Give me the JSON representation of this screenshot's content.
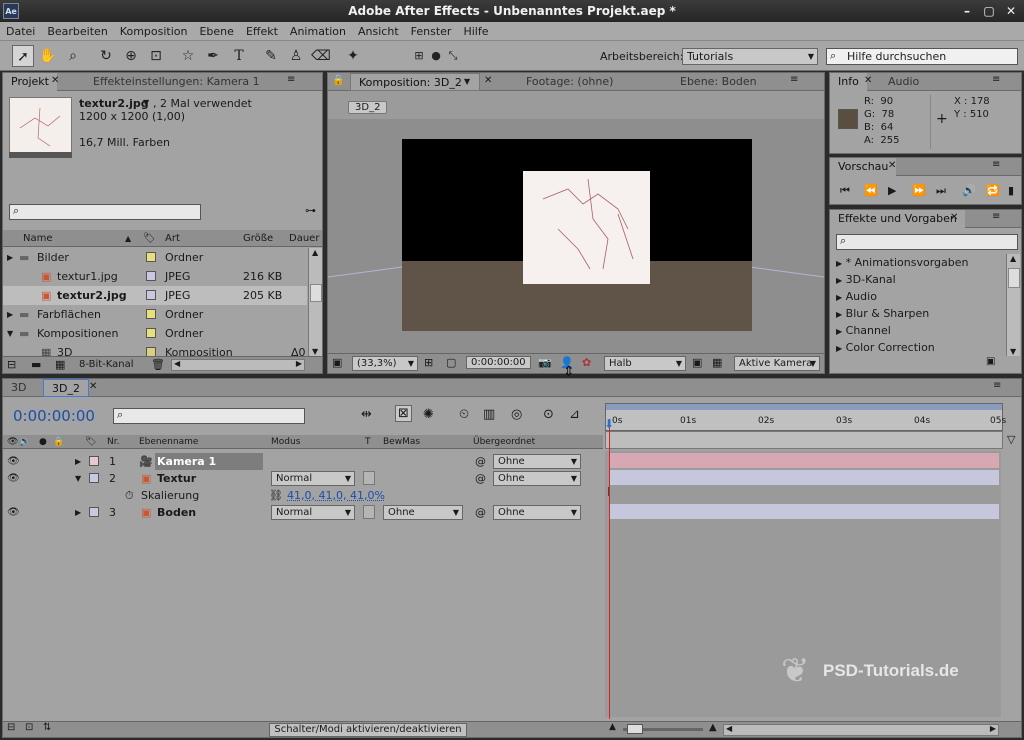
{
  "window": {
    "title": "Adobe After Effects - Unbenanntes Projekt.aep *",
    "app_icon": "Ae",
    "controls": [
      "–",
      "▢",
      "✕"
    ]
  },
  "menu": [
    "Datei",
    "Bearbeiten",
    "Komposition",
    "Ebene",
    "Effekt",
    "Animation",
    "Ansicht",
    "Fenster",
    "Hilfe"
  ],
  "toolbar": {
    "workspace_label": "Arbeitsbereich:",
    "workspace_value": "Tutorials",
    "help_placeholder": "Hilfe durchsuchen"
  },
  "project": {
    "tab_project": "Projekt",
    "tab_effects": "Effekteinstellungen: Kamera 1",
    "file_name": "textur2.jpg",
    "file_usage": ", 2 Mal verwendet",
    "file_size": "1200 x 1200 (1,00)",
    "file_colors": "16,7 Mill. Farben",
    "columns": [
      "Name",
      "Art",
      "Größe",
      "Dauer"
    ],
    "items": [
      {
        "name": "Bilder",
        "type": "Ordner",
        "size": "",
        "color": "#e8e07a"
      },
      {
        "name": "textur1.jpg",
        "type": "JPEG",
        "size": "216 KB",
        "color": "#c8c8e0"
      },
      {
        "name": "textur2.jpg",
        "type": "JPEG",
        "size": "205 KB",
        "color": "#c8c8e0"
      },
      {
        "name": "Farbflächen",
        "type": "Ordner",
        "size": "",
        "color": "#e8e07a"
      },
      {
        "name": "Kompositionen",
        "type": "Ordner",
        "size": "",
        "color": "#e8e07a"
      },
      {
        "name": "3D",
        "type": "Komposition",
        "size": "",
        "dur": "Δ0",
        "color": "#d8d080"
      }
    ],
    "bit_depth": "8-Bit-Kanal"
  },
  "comp": {
    "tab": "Komposition: 3D_2",
    "footage": "Footage: (ohne)",
    "layer": "Ebene: Boden",
    "badge": "3D_2",
    "zoom": "(33,3%)",
    "time": "0:00:00:00",
    "resolution": "Halb",
    "camera": "Aktive Kamera"
  },
  "info": {
    "tab_info": "Info",
    "tab_audio": "Audio",
    "r": "R:  90",
    "g": "G:  78",
    "b": "B:  64",
    "a": "A:  255",
    "x": "X : 178",
    "y": "Y : 510",
    "swatch": "#5a4e40"
  },
  "preview": {
    "tab": "Vorschau"
  },
  "effects": {
    "tab": "Effekte und Vorgaben",
    "items": [
      "* Animationsvorgaben",
      "3D-Kanal",
      "Audio",
      "Blur & Sharpen",
      "Channel",
      "Color Correction"
    ]
  },
  "timeline": {
    "tab_3d": "3D",
    "tab_3d2": "3D_2",
    "timecode": "0:00:00:00",
    "columns": [
      "Nr.",
      "Ebenenname",
      "Modus",
      "T",
      "BewMas",
      "Übergeordnet"
    ],
    "ticks": [
      "0s",
      "01s",
      "02s",
      "03s",
      "04s",
      "05s"
    ],
    "layers": [
      {
        "nr": "1",
        "name": "Kamera 1",
        "mode": "",
        "bewmas": "",
        "parent": "Ohne"
      },
      {
        "nr": "2",
        "name": "Textur",
        "mode": "Normal",
        "bewmas": "",
        "parent": "Ohne"
      },
      {
        "nr": "",
        "name": "Skalierung",
        "value": "41,0, 41,0, 41,0%"
      },
      {
        "nr": "3",
        "name": "Boden",
        "mode": "Normal",
        "bewmas": "Ohne",
        "parent": "Ohne"
      }
    ],
    "toggle": "Schalter/Modi aktivieren/deaktivieren"
  },
  "watermark": "PSD-Tutorials.de"
}
